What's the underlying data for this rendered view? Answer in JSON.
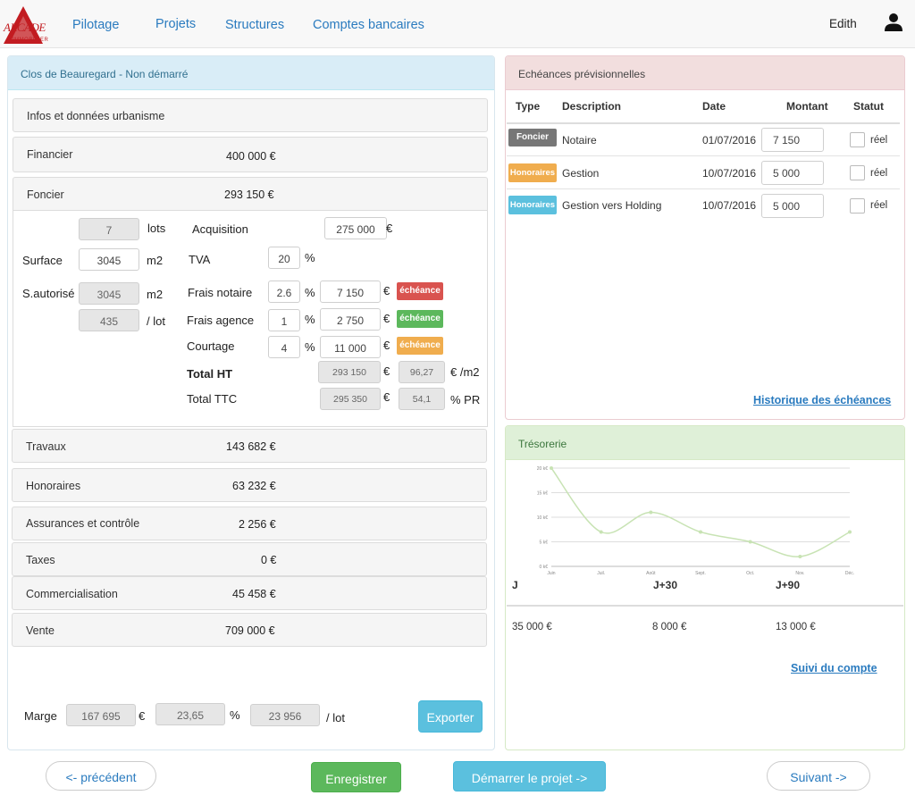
{
  "brand": {
    "name": "ARCADE",
    "sub": "IMMOBILIER",
    "color": "#c21c21"
  },
  "nav": {
    "items": [
      "Pilotage",
      "Projets",
      "Structures",
      "Comptes bancaires"
    ],
    "user": "Edith"
  },
  "left": {
    "title": "Clos de Beauregard - Non démarré",
    "sections": {
      "infos": "Infos et données urbanisme",
      "financier": {
        "label": "Financier",
        "value": "400 000 €"
      },
      "foncier": {
        "label": "Foncier",
        "value": "293 150 €"
      },
      "travaux": {
        "label": "Travaux",
        "value": "143 682 €"
      },
      "honoraires": {
        "label": "Honoraires",
        "value": "63 232 €"
      },
      "assurances": {
        "label": "Assurances et contrôle",
        "value": "2 256 €"
      },
      "taxes": {
        "label": "Taxes",
        "value": "0 €"
      },
      "commercialisation": {
        "label": "Commercialisation",
        "value": "45 458 €"
      },
      "vente": {
        "label": "Vente",
        "value": "709 000 €"
      }
    },
    "foncier": {
      "lots": "7",
      "lots_unit": "lots",
      "surface_label": "Surface",
      "surface": "3045",
      "surface_unit": "m2",
      "sauto_label": "S.autorisé",
      "sauto": "3045",
      "sauto_unit": "m2",
      "perlot": "435",
      "perlot_unit": "/ lot",
      "acquisition_label": "Acquisition",
      "acquisition": "275 000",
      "acquisition_unit": "€",
      "tva_label": "TVA",
      "tva": "20",
      "tva_unit": "%",
      "notaire_label": "Frais notaire",
      "notaire_pct": "2.6",
      "notaire_amt": "7 150",
      "agence_label": "Frais agence",
      "agence_pct": "1",
      "agence_amt": "2 750",
      "courtage_label": "Courtage",
      "courtage_pct": "4",
      "courtage_amt": "11 000",
      "pct": "%",
      "eur": "€",
      "echeance": "échéance",
      "total_ht_label": "Total HT",
      "total_ht": "293 150",
      "total_ht_m2": "96,27",
      "total_ht_m2_unit": "€ /m2",
      "total_ttc_label": "Total TTC",
      "total_ttc": "295 350",
      "total_ttc_pr": "54,1",
      "total_ttc_pr_unit": "% PR"
    },
    "marge": {
      "label": "Marge",
      "value": "167 695",
      "eur": "€",
      "pct": "23,65",
      "pct_unit": "%",
      "perlot": "23 956",
      "perlot_unit": "/ lot"
    },
    "export": "Exporter"
  },
  "echeances": {
    "title": "Echéances prévisionnelles",
    "headers": [
      "Type",
      "Description",
      "Date",
      "Montant",
      "Statut"
    ],
    "rows": [
      {
        "type": "Foncier",
        "desc": "Notaire",
        "date": "01/07/2016",
        "montant": "7 150",
        "statut": "réel"
      },
      {
        "type": "Honoraires",
        "desc": "Gestion",
        "date": "10/07/2016",
        "montant": "5 000",
        "statut": "réel"
      },
      {
        "type": "Honoraires",
        "desc": "Gestion vers Holding",
        "date": "10/07/2016",
        "montant": "5 000",
        "statut": "réel"
      }
    ],
    "history_link": "Historique des échéances"
  },
  "tresorerie": {
    "title": "Trésorerie",
    "headers": [
      "J",
      "J+30",
      "J+90"
    ],
    "values": [
      "35 000 €",
      "8 000 €",
      "13 000 €"
    ],
    "link": "Suivi du compte"
  },
  "chart_data": {
    "type": "line",
    "categories": [
      "Juin",
      "Juil.",
      "Août",
      "Sept.",
      "Oct.",
      "Nov.",
      "Déc."
    ],
    "y_ticks": [
      "0 k€",
      "5 k€",
      "10 k€",
      "15 k€",
      "20 k€"
    ],
    "ylim": [
      0,
      20
    ],
    "series": [
      {
        "values": [
          20,
          7,
          11,
          7,
          5,
          2,
          7
        ]
      }
    ],
    "color": "#c8e3b4"
  },
  "footer": {
    "prev": "<- précédent",
    "save": "Enregistrer",
    "start": "Démarrer le projet ->",
    "next": "Suivant ->"
  }
}
